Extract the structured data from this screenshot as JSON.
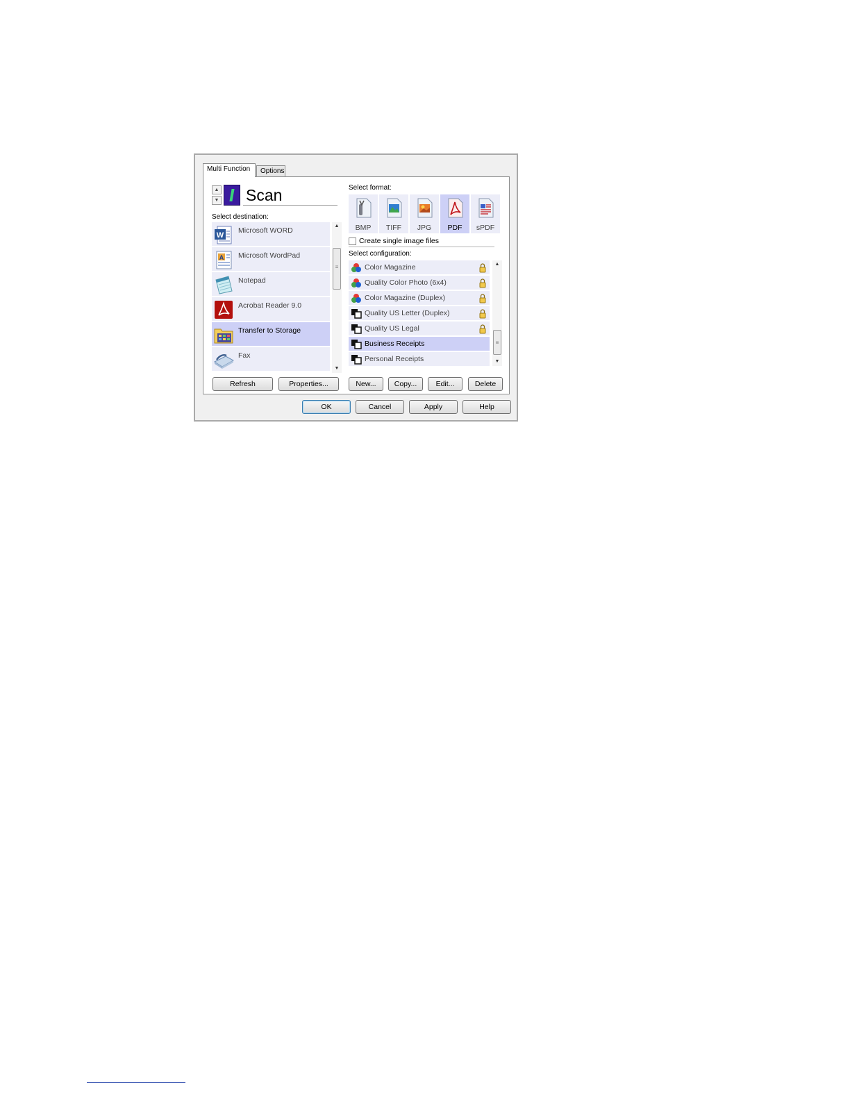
{
  "tabs": [
    {
      "label": "Multi Function"
    },
    {
      "label": "Options"
    }
  ],
  "scan": {
    "name": "Scan"
  },
  "destination": {
    "label": "Select destination:",
    "items": [
      {
        "label": "Microsoft WORD",
        "icon": "word-icon",
        "selected": false
      },
      {
        "label": "Microsoft WordPad",
        "icon": "wordpad-icon",
        "selected": false
      },
      {
        "label": "Notepad",
        "icon": "notepad-icon",
        "selected": false
      },
      {
        "label": "Acrobat Reader 9.0",
        "icon": "acrobat-icon",
        "selected": false
      },
      {
        "label": "Transfer to Storage",
        "icon": "storage-folder-icon",
        "selected": true
      },
      {
        "label": "Fax",
        "icon": "fax-icon",
        "selected": false
      }
    ],
    "refresh_label": "Refresh",
    "properties_label": "Properties..."
  },
  "format": {
    "label": "Select format:",
    "items": [
      {
        "label": "BMP",
        "icon": "bmp-file-icon",
        "selected": false
      },
      {
        "label": "TIFF",
        "icon": "tiff-file-icon",
        "selected": false
      },
      {
        "label": "JPG",
        "icon": "jpg-file-icon",
        "selected": false
      },
      {
        "label": "PDF",
        "icon": "pdf-file-icon",
        "selected": true
      },
      {
        "label": "sPDF",
        "icon": "spdf-file-icon",
        "selected": false
      }
    ],
    "single_image_label": "Create single image files",
    "single_image_checked": false
  },
  "configuration": {
    "label": "Select configuration:",
    "items": [
      {
        "label": "Color Magazine",
        "icon": "color-config-icon",
        "locked": true,
        "selected": false
      },
      {
        "label": "Quality Color Photo (6x4)",
        "icon": "color-config-icon",
        "locked": true,
        "selected": false
      },
      {
        "label": "Color Magazine (Duplex)",
        "icon": "color-config-icon",
        "locked": true,
        "selected": false
      },
      {
        "label": "Quality US Letter (Duplex)",
        "icon": "bw-config-icon",
        "locked": true,
        "selected": false
      },
      {
        "label": "Quality US Legal",
        "icon": "bw-config-icon",
        "locked": true,
        "selected": false
      },
      {
        "label": "Business Receipts",
        "icon": "bw-config-icon",
        "locked": false,
        "selected": true
      },
      {
        "label": "Personal Receipts",
        "icon": "bw-config-icon",
        "locked": false,
        "selected": false
      }
    ],
    "new_label": "New...",
    "copy_label": "Copy...",
    "edit_label": "Edit...",
    "delete_label": "Delete"
  },
  "footer": {
    "ok_label": "OK",
    "cancel_label": "Cancel",
    "apply_label": "Apply",
    "help_label": "Help"
  },
  "colors": {
    "selected_row": "#cdd0f6",
    "row": "#ecedf8",
    "dialog_bg": "#f0f0f0",
    "default_button_border": "#3c7fb1"
  }
}
